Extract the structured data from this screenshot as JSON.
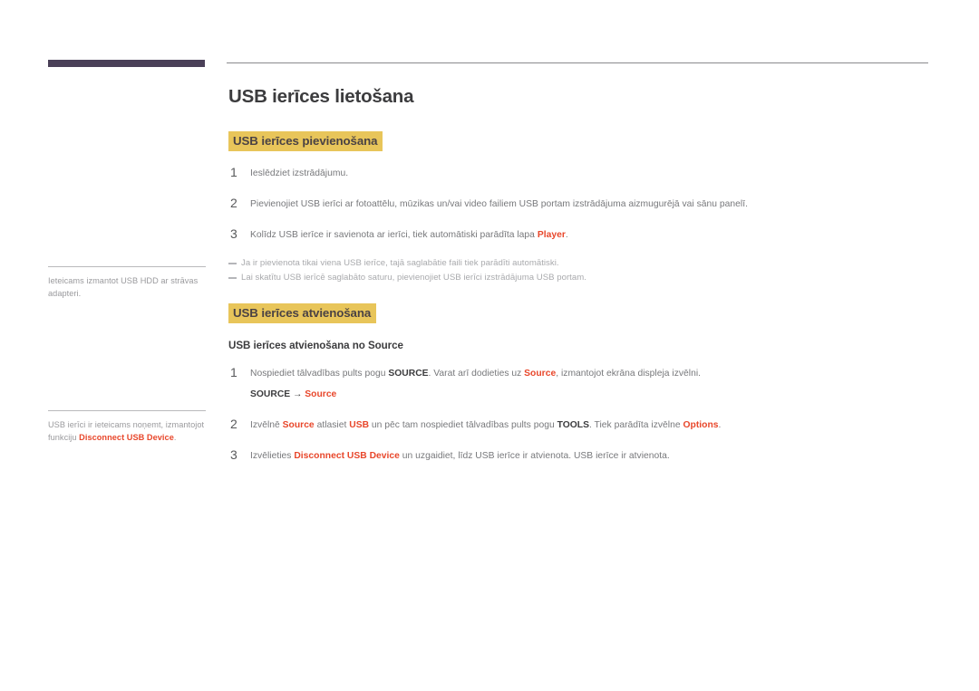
{
  "page": {
    "title": "USB ierīces lietošana"
  },
  "sidebar": {
    "notes": [
      {
        "id": "note-usb-hdd",
        "text": "Ieteicams izmantot USB HDD ar strāvas adapteri."
      },
      {
        "id": "note-disconnect",
        "text_before": "USB ierīci ir ieteicams noņemt, izmantojot funkciju ",
        "highlight": "Disconnect USB Device",
        "text_after": "."
      }
    ]
  },
  "sections": [
    {
      "id": "usb-connect",
      "heading": "USB ierīces pievienošana",
      "steps": [
        {
          "number": "1",
          "parts": [
            {
              "type": "plain",
              "text": "Ieslēdziet izstrādājumu."
            }
          ]
        },
        {
          "number": "2",
          "parts": [
            {
              "type": "plain",
              "text": "Pievienojiet USB ierīci ar fotoattēlu, mūzikas un/vai video failiem USB portam izstrādājuma aizmugurējā vai sānu panelī."
            }
          ]
        },
        {
          "number": "3",
          "parts": [
            {
              "type": "plain",
              "text": "Kolīdz USB ierīce ir savienota ar ierīci, tiek automātiski parādīta lapa "
            },
            {
              "type": "highlight",
              "text": "Player"
            },
            {
              "type": "plain",
              "text": "."
            }
          ]
        }
      ],
      "notes": [
        "Ja ir pievienota tikai viena USB ierīce, tajā saglabātie faili tiek parādīti automātiski.",
        "Lai skatītu USB ierīcē saglabāto saturu, pievienojiet USB ierīci izstrādājuma USB portam."
      ]
    },
    {
      "id": "usb-disconnect",
      "heading": "USB ierīces atvienošana",
      "subheading": "USB ierīces atvienošana no Source",
      "steps": [
        {
          "number": "1",
          "parts": [
            {
              "type": "plain",
              "text": "Nospiediet tālvadības pults pogu "
            },
            {
              "type": "bold",
              "text": "SOURCE"
            },
            {
              "type": "plain",
              "text": ". Varat arī dodieties uz "
            },
            {
              "type": "highlight",
              "text": "Source"
            },
            {
              "type": "plain",
              "text": ", izmantojot ekrāna displeja izvēlni."
            }
          ],
          "path": {
            "root": "SOURCE",
            "arrow": "→",
            "leaf": "Source"
          }
        },
        {
          "number": "2",
          "parts": [
            {
              "type": "plain",
              "text": "Izvēlnē "
            },
            {
              "type": "highlight",
              "text": "Source"
            },
            {
              "type": "plain",
              "text": " atlasiet "
            },
            {
              "type": "highlight",
              "text": "USB"
            },
            {
              "type": "plain",
              "text": " un pēc tam nospiediet tālvadības pults pogu "
            },
            {
              "type": "bold",
              "text": "TOOLS"
            },
            {
              "type": "plain",
              "text": ". Tiek parādīta izvēlne "
            },
            {
              "type": "highlight",
              "text": "Options"
            },
            {
              "type": "plain",
              "text": "."
            }
          ]
        },
        {
          "number": "3",
          "parts": [
            {
              "type": "plain",
              "text": "Izvēlieties "
            },
            {
              "type": "highlight",
              "text": "Disconnect USB Device"
            },
            {
              "type": "plain",
              "text": " un uzgaidiet, līdz USB ierīce ir atvienota. USB ierīce ir atvienota."
            }
          ]
        }
      ]
    }
  ],
  "colors": {
    "accent_orange": "#e8472b",
    "highlight_gold": "#e8c55a",
    "header_purple": "#4a4058",
    "body_gray": "#77787b"
  }
}
